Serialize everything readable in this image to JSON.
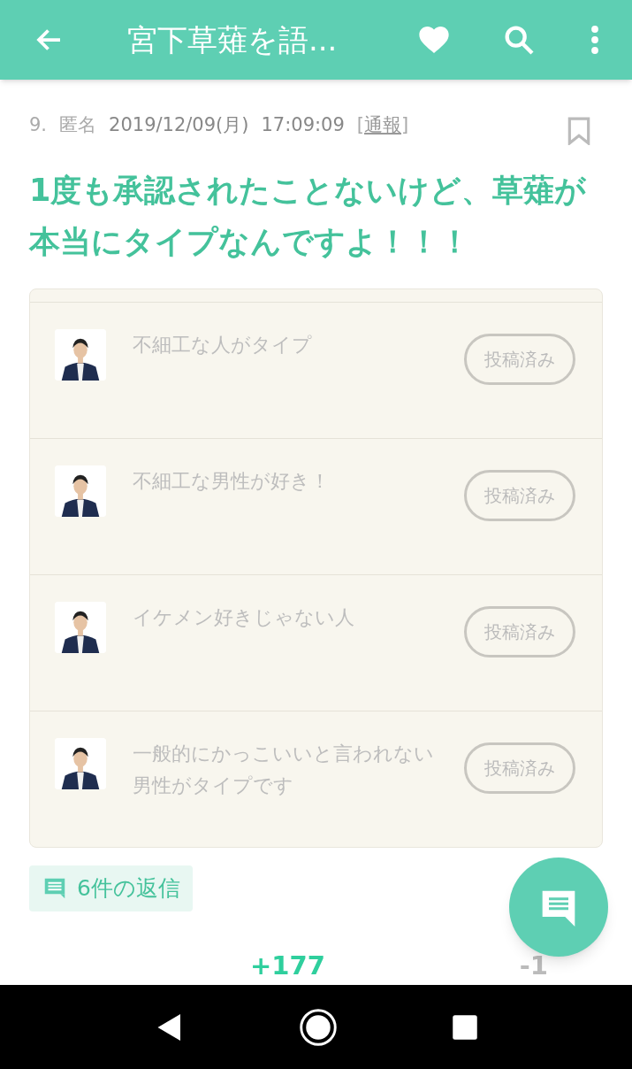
{
  "app_bar": {
    "title": "宮下草薙を語..."
  },
  "post": {
    "number": "9.",
    "author": "匿名",
    "date": "2019/12/09(月)",
    "time": "17:09:09",
    "report_open": "[",
    "report": "通報",
    "report_close": "]",
    "body": "1度も承認されたことないけど、草薙が本当にタイプなんですよ！！！"
  },
  "topics": [
    {
      "kind": "picture",
      "text": "不細工な人がタイプ",
      "button": "投稿済み"
    },
    {
      "kind": "picture",
      "text": "不細工な男性が好き！",
      "button": "投稿済み"
    },
    {
      "kind": "picture",
      "text": "イケメン好きじゃない人",
      "button": "投稿済み"
    },
    {
      "kind": "picture",
      "text": "一般的にかっこいいと言われない男性がタイプです",
      "button": "投稿済み"
    }
  ],
  "replies": {
    "label": "6件の返信"
  },
  "votes": {
    "plus": "+177",
    "minus": "-1"
  }
}
